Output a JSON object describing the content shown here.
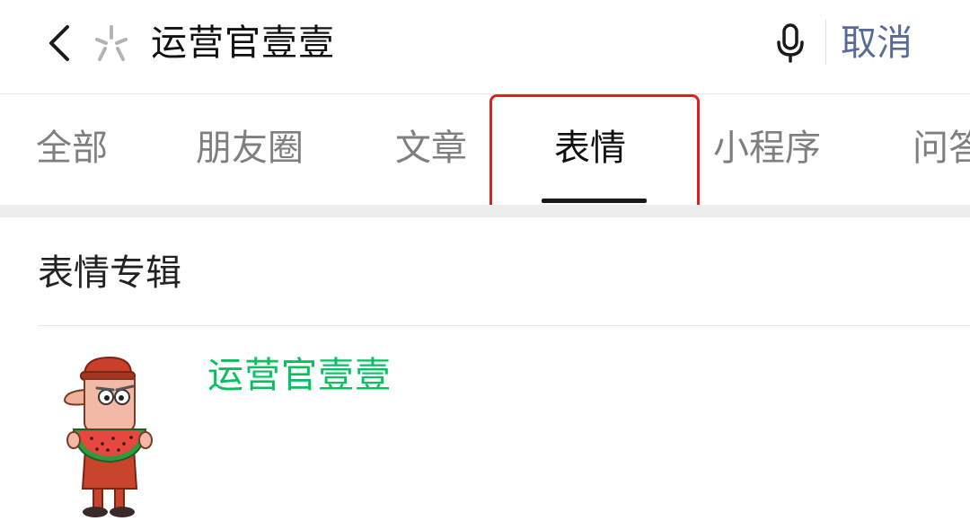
{
  "search": {
    "query": "运营官壹壹",
    "cancel_label": "取消",
    "icons": {
      "back": "chevron-left-icon",
      "logo": "sogou-star-icon",
      "mic": "microphone-icon"
    }
  },
  "tabs": [
    {
      "label": "全部",
      "active": false
    },
    {
      "label": "朋友圈",
      "active": false
    },
    {
      "label": "文章",
      "active": false
    },
    {
      "label": "表情",
      "active": true
    },
    {
      "label": "小程序",
      "active": false
    },
    {
      "label": "问答",
      "active": false
    }
  ],
  "sticker_section": {
    "title": "表情专辑",
    "albums": [
      {
        "name": "运营官壹壹",
        "thumbnail_icon": "watermelon-man-sticker-icon"
      }
    ]
  },
  "colors": {
    "primary_text": "#111111",
    "tab_inactive": "#7f7f7f",
    "cancel_link": "#576b95",
    "album_name": "#07c160",
    "annotation_box": "#e02020"
  }
}
